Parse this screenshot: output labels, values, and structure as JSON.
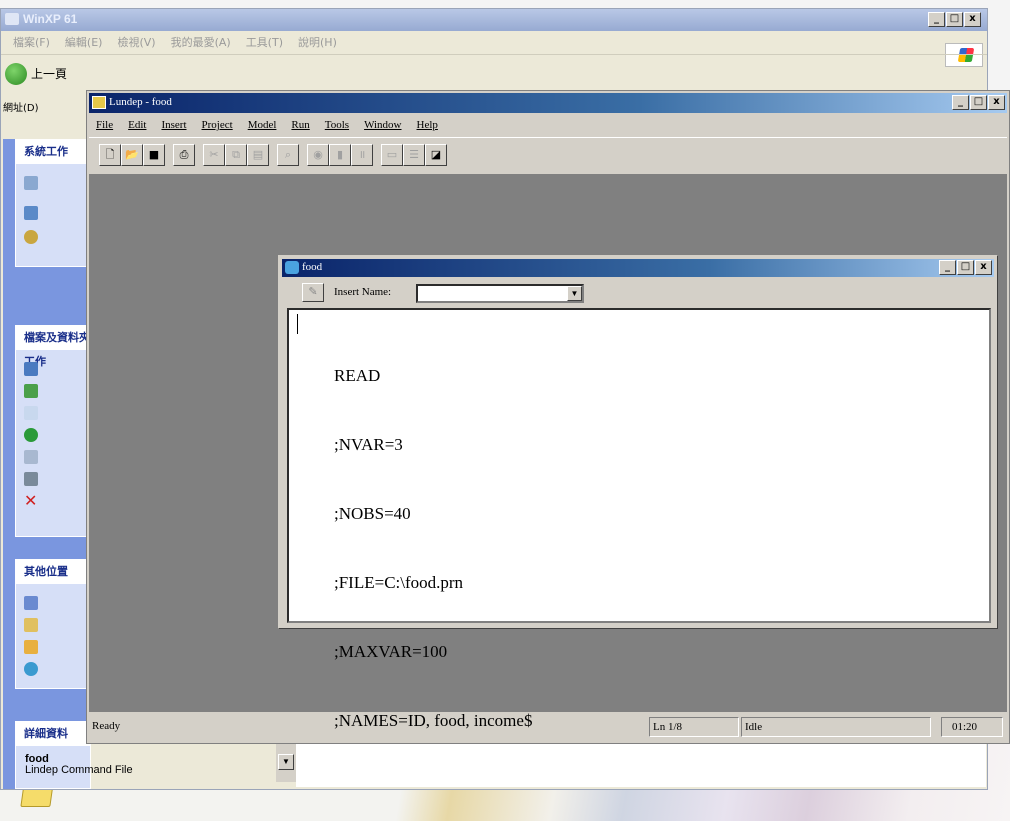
{
  "explorer": {
    "title": "WinXP 61",
    "menu": [
      "檔案(F)",
      "編輯(E)",
      "檢視(V)",
      "我的最愛(A)",
      "工具(T)",
      "說明(H)"
    ],
    "back_label": "上一頁",
    "address_label": "網址(D)",
    "side_panel": {
      "tasks_title": "系統工作",
      "files_title": "檔案及資料夾工作",
      "other_title": "其他位置",
      "details_title": "詳細資料",
      "selected_name": "food",
      "selected_type": "Lindep Command File"
    }
  },
  "lundep": {
    "title": "Lundep - food",
    "menu": [
      "File",
      "Edit",
      "Insert",
      "Project",
      "Model",
      "Run",
      "Tools",
      "Window",
      "Help"
    ],
    "toolbar_icons": [
      "new-icon",
      "open-icon",
      "save-icon",
      "print-icon",
      "cut-icon",
      "copy-icon",
      "paste-icon",
      "find-icon",
      "run-icon",
      "stop-icon",
      "pause-icon",
      "window-icon",
      "list-icon",
      "chart-icon"
    ],
    "status": {
      "message": "Ready",
      "position": "Ln 1/8",
      "state": "Idle",
      "time": "01:20"
    }
  },
  "food_window": {
    "title": "food",
    "insert_name_label": "Insert Name:",
    "insert_name_value": "",
    "code_lines": [
      "READ",
      ";NVAR=3",
      ";NOBS=40",
      ";FILE=C:\\food.prn",
      ";MAXVAR=100",
      ";NAMES=ID, food, income$"
    ]
  },
  "caption_buttons": {
    "minimize": "_",
    "maximize": "□",
    "close": "x"
  }
}
